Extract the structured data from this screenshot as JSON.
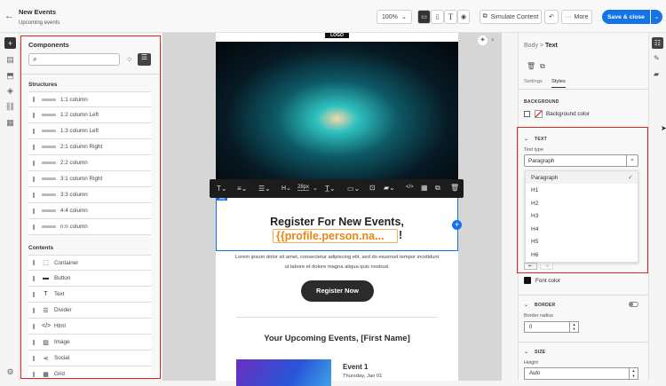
{
  "header": {
    "title": "New Events",
    "subtitle": "Upcoming events",
    "zoom": "100%",
    "simulate": "Simulate Content",
    "more": "More",
    "save": "Save & close"
  },
  "components": {
    "title": "Components",
    "search_placeholder": "",
    "structures_title": "Structures",
    "structures": [
      "1:1 column",
      "1:2 column Left",
      "1:3 column Left",
      "2:1 column Right",
      "2:2 column",
      "3:1 column Right",
      "3:3 column",
      "4:4 column",
      "n:n column"
    ],
    "contents_title": "Contents",
    "contents": [
      {
        "label": "Container",
        "icon": "⬚"
      },
      {
        "label": "Button",
        "icon": "▬"
      },
      {
        "label": "Text",
        "icon": "T"
      },
      {
        "label": "Divider",
        "icon": "☰"
      },
      {
        "label": "Html",
        "icon": "</>"
      },
      {
        "label": "Image",
        "icon": "▨"
      },
      {
        "label": "Social",
        "icon": "⋖"
      },
      {
        "label": "Grid",
        "icon": "▦"
      }
    ]
  },
  "email": {
    "logo": "LOGO",
    "toolbar_size": "28px",
    "text_tag": "Text",
    "heading": "Register For New Events,",
    "personalization": "{{profile.person.na...",
    "exclaim": "!",
    "lorem": "Lorem ipsum dolor sit amet, consectetur adipiscing elit, sed do eiusmod tempor incididunt ut labore et dolore magna aliqua quis nostrud.",
    "button": "Register Now",
    "section_title": "Your Upcoming Events, [First Name]",
    "event_title": "Event 1",
    "event_date": "Thursday, Jan 01"
  },
  "props": {
    "breadcrumb_parent": "Body",
    "breadcrumb_sep": ">",
    "breadcrumb_current": "Text",
    "tab_settings": "Settings",
    "tab_styles": "Styles",
    "background_title": "BACKGROUND",
    "background_color": "Background color",
    "text_title": "TEXT",
    "text_type_label": "Text type",
    "text_type_value": "Paragraph",
    "text_type_options": [
      "Paragraph",
      "H1",
      "H2",
      "H3",
      "H4",
      "H5",
      "H6"
    ],
    "font_color": "Font color",
    "border_title": "BORDER",
    "border_radius_label": "Border radius",
    "border_radius_value": "0",
    "size_title": "SIZE",
    "height_label": "Height",
    "height_value": "Auto"
  },
  "colors": {
    "accent": "#1473e6",
    "highlight": "#e2231a",
    "personalization": "#e68619"
  }
}
